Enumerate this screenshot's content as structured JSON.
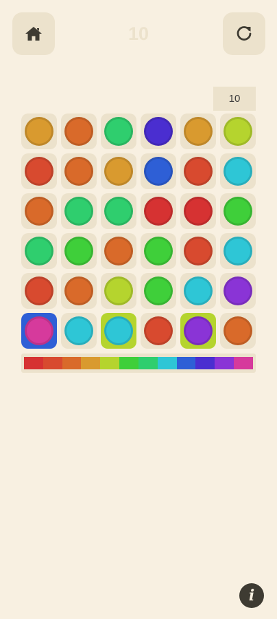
{
  "header": {
    "home_icon": "home-icon",
    "restart_icon": "restart-icon",
    "moves": "10"
  },
  "target": "10",
  "board": {
    "rows": [
      [
        {
          "color": "#d99a2f"
        },
        {
          "color": "#d96a2a"
        },
        {
          "color": "#2fce6e"
        },
        {
          "color": "#4a2ed0"
        },
        {
          "color": "#d99a2f"
        },
        {
          "color": "#b5d42e"
        }
      ],
      [
        {
          "color": "#d84a2f"
        },
        {
          "color": "#d96a2a"
        },
        {
          "color": "#d99a2f"
        },
        {
          "color": "#2e5fd6"
        },
        {
          "color": "#d84a2f"
        },
        {
          "color": "#2ec6d6"
        }
      ],
      [
        {
          "color": "#d96a2a"
        },
        {
          "color": "#2fce6e"
        },
        {
          "color": "#2fce6e"
        },
        {
          "color": "#d63232"
        },
        {
          "color": "#d63232"
        },
        {
          "color": "#3fcf3a"
        }
      ],
      [
        {
          "color": "#2fce6e"
        },
        {
          "color": "#3fcf3a"
        },
        {
          "color": "#d96a2a"
        },
        {
          "color": "#3fcf3a"
        },
        {
          "color": "#d84a2f"
        },
        {
          "color": "#2ec6d6"
        }
      ],
      [
        {
          "color": "#d84a2f"
        },
        {
          "color": "#d96a2a"
        },
        {
          "color": "#b5d42e"
        },
        {
          "color": "#3fcf3a"
        },
        {
          "color": "#2ec6d6"
        },
        {
          "color": "#8a34d6"
        }
      ],
      [
        {
          "color": "#d63a9c",
          "bg": "#2e5fd6"
        },
        {
          "color": "#2ec6d6"
        },
        {
          "color": "#2ec6d6",
          "bg": "#b5d42e"
        },
        {
          "color": "#d84a2f"
        },
        {
          "color": "#8a34d6",
          "bg": "#b5d42e"
        },
        {
          "color": "#d96a2a"
        }
      ]
    ]
  },
  "spectrum": [
    "#d63232",
    "#d84a2f",
    "#d96a2a",
    "#d99a2f",
    "#b5d42e",
    "#3fcf3a",
    "#2fce6e",
    "#2ec6d6",
    "#2e5fd6",
    "#4a2ed0",
    "#8a34d6",
    "#d63a9c"
  ],
  "info_icon_text": "i"
}
